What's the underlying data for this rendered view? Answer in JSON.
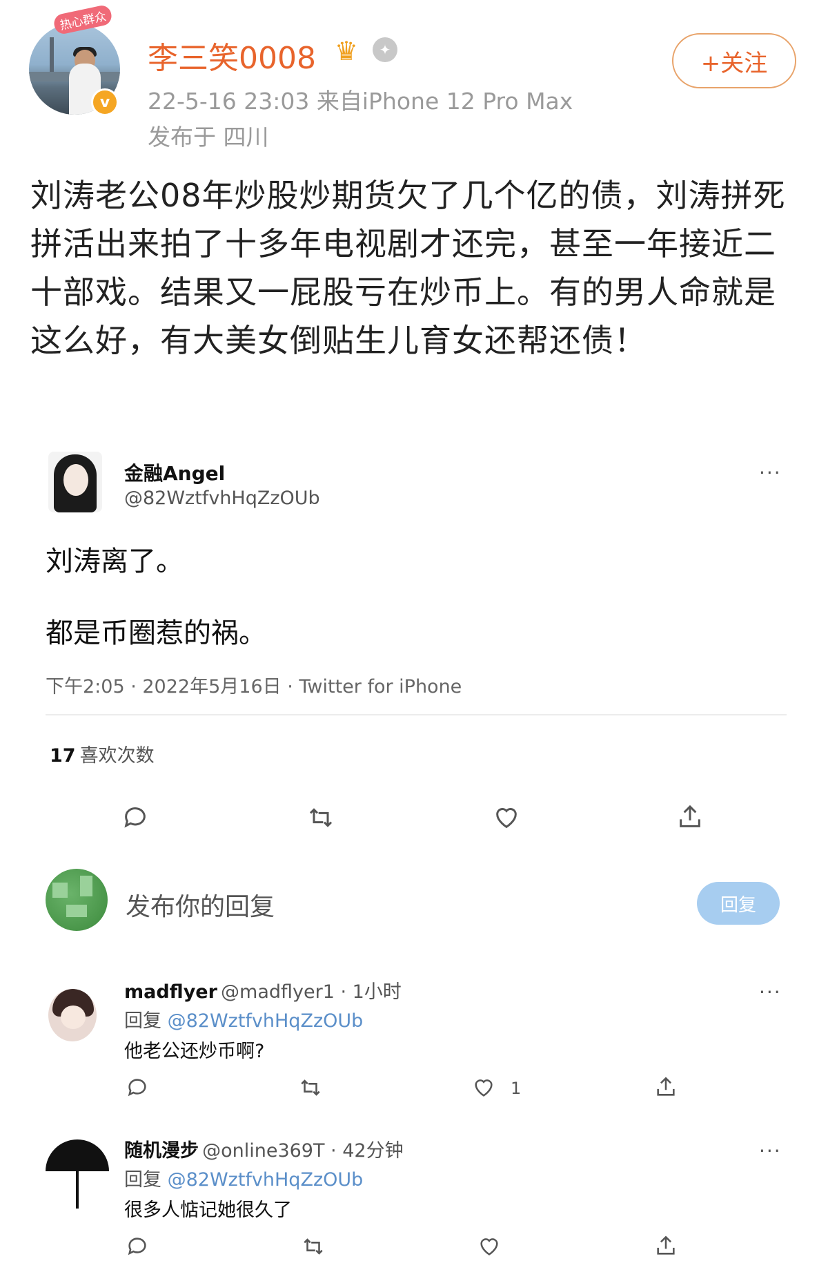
{
  "post": {
    "avatar_tag": "热心群众",
    "verified_mark": "v",
    "username": "李三笑0008",
    "meta": "22-5-16 23:03  来自iPhone 12 Pro Max",
    "location": "发布于 四川",
    "follow_label": "+关注",
    "body": "刘涛老公08年炒股炒期货欠了几个亿的债，刘涛拼死拼活出来拍了十多年电视剧才还完，甚至一年接近二十部戏。结果又一屁股亏在炒币上。有的男人命就是这么好，有大美女倒贴生儿育女还帮还债！"
  },
  "tweet": {
    "name": "金融Angel",
    "handle": "@82WztfvhHqZzOUb",
    "more": "···",
    "text_1": "刘涛离了。",
    "text_2": "都是币圈惹的祸。",
    "meta": "下午2:05 · 2022年5月16日 · Twitter for iPhone",
    "likes_count": "17",
    "likes_label": "喜欢次数",
    "icons": {
      "reply": "reply-icon",
      "retweet": "retweet-icon",
      "like": "like-icon",
      "share": "share-icon"
    }
  },
  "compose": {
    "placeholder": "发布你的回复",
    "button_label": "回复"
  },
  "replies": [
    {
      "name": "madflyer",
      "handle": "@madflyer1 · 1小时",
      "reply_prefix": "回复",
      "reply_to": "@82WztfvhHqZzOUb",
      "text": "他老公还炒币啊?",
      "like_count": "1",
      "more": "···"
    },
    {
      "name": "随机漫步",
      "handle": "@online369T · 42分钟",
      "reply_prefix": "回复",
      "reply_to": "@82WztfvhHqZzOUb",
      "text": "很多人惦记她很久了",
      "like_count": "",
      "more": "···"
    }
  ],
  "colors": {
    "username": "#e8642c",
    "mention": "#5b8fc9",
    "reply_button": "#a7cdf0"
  }
}
